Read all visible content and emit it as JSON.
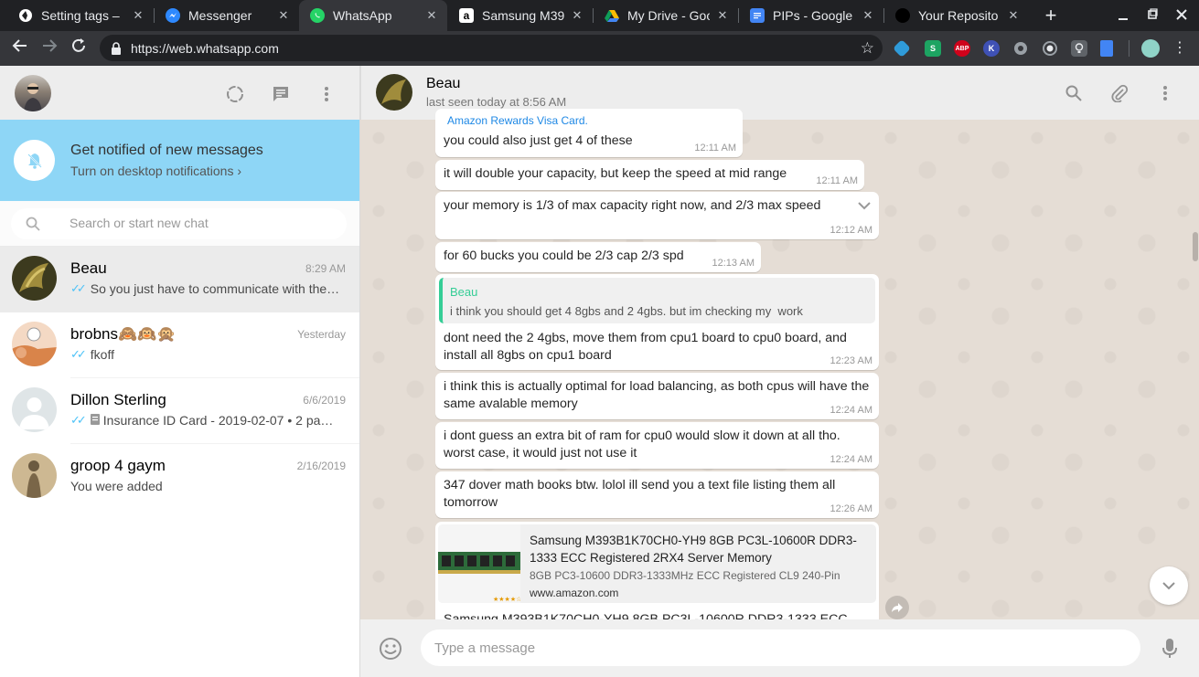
{
  "browser": {
    "tabs": [
      {
        "title": "Setting tags –",
        "icon": "globe-icon",
        "color": "#ffffff"
      },
      {
        "title": "Messenger",
        "icon": "messenger-icon",
        "color": "#2e89ff"
      },
      {
        "title": "WhatsApp",
        "icon": "whatsapp-icon",
        "color": "#25d366"
      },
      {
        "title": "Samsung M39",
        "icon": "amazon-icon",
        "color": "#ffffff"
      },
      {
        "title": "My Drive - Goo",
        "icon": "drive-icon",
        "color": "#fbbc04"
      },
      {
        "title": "PIPs - Google",
        "icon": "docs-icon",
        "color": "#4285f4"
      },
      {
        "title": "Your Reposito",
        "icon": "github-icon",
        "color": "#000000"
      }
    ],
    "url": "https://web.whatsapp.com",
    "extensions": [
      {
        "icon": "shield-ext-icon",
        "color": "#2f9bd9",
        "label": ""
      },
      {
        "icon": "s-ext-icon",
        "color": "#1da462",
        "label": "S"
      },
      {
        "icon": "abp-ext-icon",
        "color": "#d0021b",
        "label": "ABP"
      },
      {
        "icon": "k-ext-icon",
        "color": "#3f51b5",
        "label": "K"
      },
      {
        "icon": "chrome-ext-icon",
        "color": "#9aa0a6",
        "label": ""
      },
      {
        "icon": "circle-ext-icon",
        "color": "#9aa0a6",
        "label": ""
      },
      {
        "icon": "bulb-ext-icon",
        "color": "#9aa0a6",
        "label": ""
      },
      {
        "icon": "doc-ext-icon",
        "color": "#4285f4",
        "label": ""
      }
    ]
  },
  "sidebar": {
    "notification": {
      "title": "Get notified of new messages",
      "subtitle": "Turn on desktop notifications"
    },
    "search_placeholder": "Search or start new chat",
    "chats": [
      {
        "name": "Beau",
        "time": "8:29 AM",
        "preview": "So you just have to communicate with the…",
        "ticks": true,
        "doc": false,
        "avatar_color": "#4a4a2a"
      },
      {
        "name": "brobns🙈🙉🙊",
        "time": "Yesterday",
        "preview": "fkoff",
        "ticks": true,
        "doc": false,
        "avatar_color": "#e8a87c"
      },
      {
        "name": "Dillon Sterling",
        "time": "6/6/2019",
        "preview": "Insurance ID Card - 2019-02-07 • 2 pa…",
        "ticks": true,
        "doc": true,
        "avatar_color": "#dfe5e7"
      },
      {
        "name": "groop 4 gaym",
        "time": "2/16/2019",
        "preview": "You were added",
        "ticks": false,
        "doc": false,
        "avatar_color": "#b8a07a"
      }
    ]
  },
  "conversation": {
    "name": "Beau",
    "status": "last seen today at 8:56 AM",
    "compose_placeholder": "Type a message",
    "messages": [
      {
        "lines": [
          "you could also just get 4 of these"
        ],
        "time": "12:11 AM"
      },
      {
        "lines": [
          "it will double your capacity, but keep the speed at mid range"
        ],
        "time": "12:11 AM"
      },
      {
        "lines": [
          "your memory is 1/3 of max capacity right now, and 2/3 max speed"
        ],
        "time": "12:12 AM"
      },
      {
        "lines": [
          "for 60 bucks you could be 2/3 cap 2/3 spd"
        ],
        "time": "12:13 AM"
      },
      {
        "quote_name": "Beau",
        "quote_text": "i think you should get 4 8gbs and 2 4gbs. but im checking my  work",
        "lines": [
          "dont need the 2 4gbs, move them from cpu1 board to cpu0 board, and",
          "install all 8gbs on cpu1 board"
        ],
        "time": "12:23 AM"
      },
      {
        "lines": [
          "i think this is actually optimal for load balancing, as both cpus will have the",
          "same avalable memory"
        ],
        "time": "12:24 AM"
      },
      {
        "lines": [
          "i dont guess an extra bit of ram for cpu0 would slow it down at all tho.",
          "worst case, it would just not use it"
        ],
        "time": "12:24 AM"
      },
      {
        "lines": [
          "347 dover math books btw. lolol ill send you a text file listing them all",
          "tomorrow"
        ],
        "time": "12:26 AM"
      }
    ],
    "link_preview": {
      "title": "Samsung M393B1K70CH0-YH9 8GB PC3L-10600R DDR3-1333 ECC Registered 2RX4 Server Memory",
      "description": "8GB PC3-10600 DDR3-1333MHz ECC Registered CL9 240-Pin",
      "site": "www.amazon.com",
      "cutoff_text": "Samsung M393B1K70CH0-YH9 8GB PC3L-10600R DDR3-1333 ECC",
      "top_cutoff_text": "Amazon Rewards Visa Card."
    }
  }
}
